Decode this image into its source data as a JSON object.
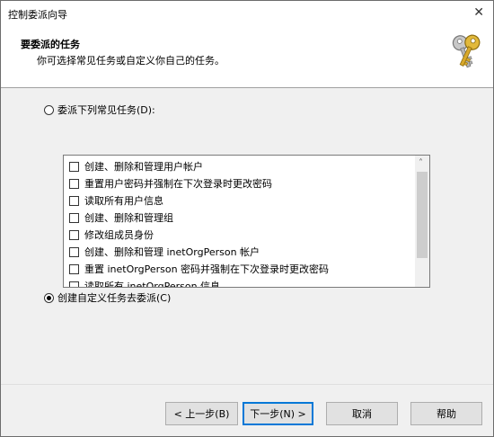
{
  "window": {
    "title": "控制委派向导",
    "close_glyph": "✕"
  },
  "header": {
    "title": "要委派的任务",
    "subtitle": "你可选择常见任务或自定义你自己的任务。",
    "icon": "keys-icon"
  },
  "options": {
    "common_tasks_label": "委派下列常见任务(D):",
    "common_tasks_selected": false,
    "custom_task_label": "创建自定义任务去委派(C)",
    "custom_task_selected": true
  },
  "task_list": {
    "items": [
      {
        "label": "创建、删除和管理用户帐户",
        "checked": false
      },
      {
        "label": "重置用户密码并强制在下次登录时更改密码",
        "checked": false
      },
      {
        "label": "读取所有用户信息",
        "checked": false
      },
      {
        "label": "创建、删除和管理组",
        "checked": false
      },
      {
        "label": "修改组成员身份",
        "checked": false
      },
      {
        "label": "创建、删除和管理 inetOrgPerson 帐户",
        "checked": false
      },
      {
        "label": "重置 inetOrgPerson 密码并强制在下次登录时更改密码",
        "checked": false
      },
      {
        "label": "读取所有 inetOrgPerson 信息",
        "checked": false
      }
    ],
    "scroll_up_glyph": "˄"
  },
  "buttons": {
    "back": "< 上一步(B)",
    "next": "下一步(N) >",
    "cancel": "取消",
    "help": "帮助"
  }
}
